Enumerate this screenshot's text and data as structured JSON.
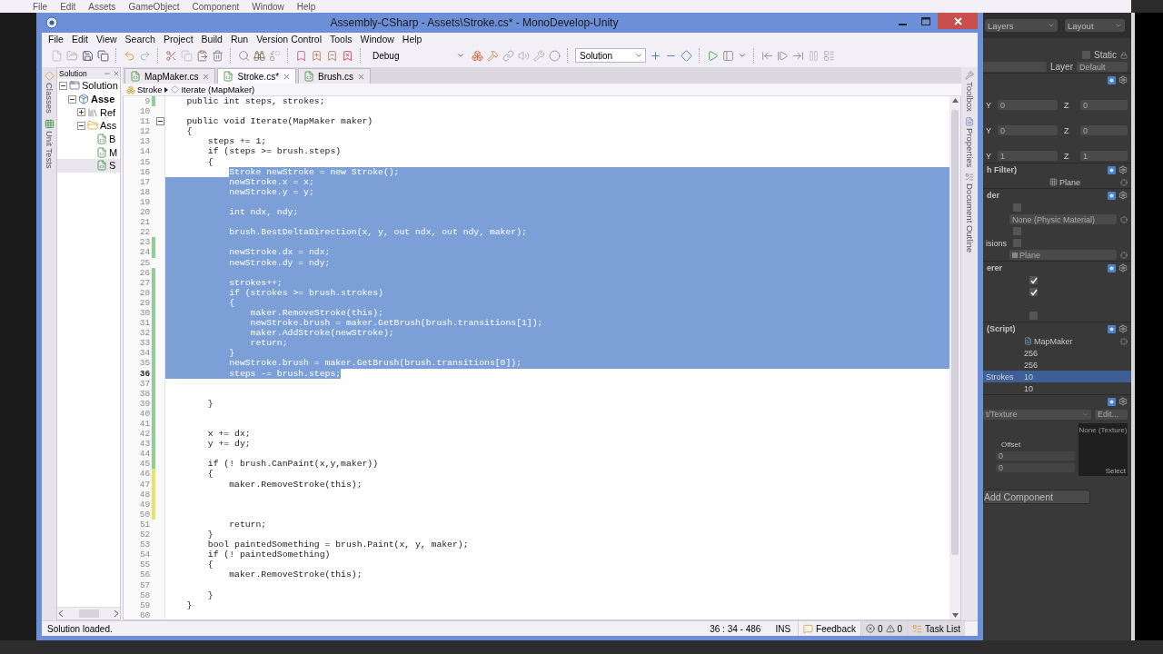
{
  "unity_menu": [
    "File",
    "Edit",
    "Assets",
    "GameObject",
    "Component",
    "Window",
    "Help"
  ],
  "window": {
    "title": "Assembly-CSharp - Assets\\Stroke.cs* - MonoDevelop-Unity"
  },
  "menu": [
    "File",
    "Edit",
    "View",
    "Search",
    "Project",
    "Build",
    "Run",
    "Version Control",
    "Tools",
    "Window",
    "Help"
  ],
  "toolbar": {
    "configuration": "Debug",
    "target": "Solution"
  },
  "left_pads": [
    "Classes",
    "Unit Tests"
  ],
  "solution_panel": {
    "title": "Solution",
    "tree": [
      {
        "label": "Solution",
        "kind": "solution",
        "expanded": true,
        "selected": false,
        "children": [
          {
            "label": "Asse",
            "kind": "project",
            "expanded": true,
            "selected": false,
            "children": [
              {
                "label": "Ref",
                "kind": "references",
                "expanded": false,
                "selected": false
              },
              {
                "label": "Ass",
                "kind": "folder",
                "expanded": true,
                "selected": false,
                "children": [
                  {
                    "label": "B",
                    "kind": "file",
                    "selected": false
                  },
                  {
                    "label": "M",
                    "kind": "file",
                    "selected": false
                  },
                  {
                    "label": "S",
                    "kind": "file",
                    "selected": true
                  }
                ]
              }
            ]
          }
        ]
      }
    ]
  },
  "tabs": [
    {
      "label": "MapMaker.cs",
      "selected": false
    },
    {
      "label": "Stroke.cs*",
      "selected": true
    },
    {
      "label": "Brush.cs",
      "selected": false
    }
  ],
  "breadcrumb": {
    "class": "Stroke",
    "member": "Iterate (MapMaker)"
  },
  "editor": {
    "lines": [
      {
        "number": "9",
        "text": "    public int steps, strokes;",
        "selected": false,
        "color": "#8fd18f",
        "current": false,
        "fold": false
      },
      {
        "number": "10",
        "selected": false,
        "current": false,
        "fold": false
      },
      {
        "number": "11",
        "text": "    public void Iterate(MapMaker maker)",
        "selected": false,
        "current": false,
        "fold": true
      },
      {
        "number": "12",
        "text": "    {",
        "selected": false,
        "current": false,
        "fold": false
      },
      {
        "number": "13",
        "text": "        steps += 1;",
        "selected": false,
        "current": false,
        "fold": false
      },
      {
        "number": "14",
        "text": "        if (steps >= brush.steps)",
        "selected": false,
        "current": false,
        "fold": false
      },
      {
        "number": "15",
        "text": "        {",
        "selected": false,
        "current": false,
        "fold": false
      },
      {
        "number": "16",
        "text": "            Stroke newStroke = new Stroke();",
        "selected": true,
        "current": false,
        "fold": false
      },
      {
        "number": "17",
        "text": "            newStroke.x = x;",
        "selected": true,
        "current": false,
        "fold": false
      },
      {
        "number": "18",
        "text": "            newStroke.y = y;",
        "selected": true,
        "current": false,
        "fold": false
      },
      {
        "number": "19",
        "selected": true,
        "current": false,
        "fold": false
      },
      {
        "number": "20",
        "text": "            int ndx, ndy;",
        "selected": true,
        "current": false,
        "fold": false
      },
      {
        "number": "21",
        "selected": true,
        "current": false,
        "fold": false
      },
      {
        "number": "22",
        "text": "            brush.BestDeltaDirection(x, y, out ndx, out ndy, maker);",
        "selected": true,
        "current": false,
        "fold": false
      },
      {
        "number": "23",
        "selected": true,
        "color": "#8fd18f",
        "current": false,
        "fold": false
      },
      {
        "number": "24",
        "text": "            newStroke.dx = ndx;",
        "selected": true,
        "color": "#8fd18f",
        "current": false,
        "fold": false
      },
      {
        "number": "25",
        "text": "            newStroke.dy = ndy;",
        "selected": true,
        "current": false,
        "fold": false
      },
      {
        "number": "26",
        "selected": true,
        "color": "#8fd18f",
        "current": false,
        "fold": false
      },
      {
        "number": "27",
        "text": "            strokes++;",
        "selected": true,
        "color": "#8fd18f",
        "current": false,
        "fold": false
      },
      {
        "number": "28",
        "text": "            if (strokes >= brush.strokes)",
        "selected": true,
        "color": "#8fd18f",
        "current": false,
        "fold": false
      },
      {
        "number": "29",
        "text": "            {",
        "selected": true,
        "color": "#8fd18f",
        "current": false,
        "fold": false
      },
      {
        "number": "30",
        "text": "                maker.RemoveStroke(this);",
        "selected": true,
        "color": "#8fd18f",
        "current": false,
        "fold": false
      },
      {
        "number": "31",
        "text": "                newStroke.brush = maker.GetBrush(brush.transitions[1]);",
        "selected": true,
        "color": "#8fd18f",
        "current": false,
        "fold": false
      },
      {
        "number": "32",
        "text": "                maker.AddStroke(newStroke);",
        "selected": true,
        "color": "#8fd18f",
        "current": false,
        "fold": false
      },
      {
        "number": "33",
        "text": "                return;",
        "selected": true,
        "color": "#8fd18f",
        "current": false,
        "fold": false
      },
      {
        "number": "34",
        "text": "            }",
        "selected": true,
        "color": "#8fd18f",
        "current": false,
        "fold": false
      },
      {
        "number": "35",
        "text": "            newStroke.brush = maker.GetBrush(brush.transitions[0]);",
        "selected": true,
        "color": "#8fd18f",
        "current": false,
        "fold": false
      },
      {
        "number": "36",
        "text": "            steps -= brush.steps;",
        "selected": true,
        "color": "#8fd18f",
        "current": true,
        "fold": false
      },
      {
        "number": "37",
        "selected": false,
        "color": "#8fd18f",
        "current": false,
        "fold": false
      },
      {
        "number": "38",
        "selected": false,
        "color": "#8fd18f",
        "current": false,
        "fold": false
      },
      {
        "number": "39",
        "text": "        }",
        "selected": false,
        "color": "#8fd18f",
        "current": false,
        "fold": false
      },
      {
        "number": "40",
        "selected": false,
        "color": "#8fd18f",
        "current": false,
        "fold": false
      },
      {
        "number": "41",
        "selected": false,
        "color": "#8fd18f",
        "current": false,
        "fold": false
      },
      {
        "number": "42",
        "text": "        x += dx;",
        "selected": false,
        "color": "#8fd18f",
        "current": false,
        "fold": false
      },
      {
        "number": "43",
        "text": "        y += dy;",
        "selected": false,
        "color": "#8fd18f",
        "current": false,
        "fold": false
      },
      {
        "number": "44",
        "selected": false,
        "color": "#8fd18f",
        "current": false,
        "fold": false
      },
      {
        "number": "45",
        "text": "        if (! brush.CanPaint(x,y,maker))",
        "selected": false,
        "color": "#8fd18f",
        "current": false,
        "fold": false
      },
      {
        "number": "46",
        "text": "        {",
        "selected": false,
        "color": "#e9e36a",
        "current": false,
        "fold": false
      },
      {
        "number": "47",
        "text": "            maker.RemoveStroke(this);",
        "selected": false,
        "color": "#e9e36a",
        "current": false,
        "fold": false
      },
      {
        "number": "48",
        "selected": false,
        "color": "#e9e36a",
        "current": false,
        "fold": false
      },
      {
        "number": "49",
        "selected": false,
        "color": "#e9e36a",
        "current": false,
        "fold": false
      },
      {
        "number": "50",
        "selected": false,
        "color": "#e9e36a",
        "current": false,
        "fold": false
      },
      {
        "number": "51",
        "text": "            return;",
        "selected": false,
        "current": false,
        "fold": false
      },
      {
        "number": "52",
        "text": "        }",
        "selected": false,
        "current": false,
        "fold": false
      },
      {
        "number": "53",
        "text": "        bool paintedSomething = brush.Paint(x, y, maker);",
        "selected": false,
        "current": false,
        "fold": false
      },
      {
        "number": "54",
        "text": "        if (! paintedSomething)",
        "selected": false,
        "current": false,
        "fold": false
      },
      {
        "number": "55",
        "text": "        {",
        "selected": false,
        "current": false,
        "fold": false
      },
      {
        "number": "56",
        "text": "            maker.RemoveStroke(this);",
        "selected": false,
        "current": false,
        "fold": false
      },
      {
        "number": "57",
        "selected": false,
        "current": false,
        "fold": false
      },
      {
        "number": "58",
        "text": "        }",
        "selected": false,
        "current": false,
        "fold": false
      },
      {
        "number": "59",
        "text": "    }",
        "selected": false,
        "current": false,
        "fold": false
      },
      {
        "number": "60",
        "selected": false,
        "current": false,
        "fold": false
      }
    ]
  },
  "right_pads": [
    "Toolbox",
    "Properties",
    "Document Outline"
  ],
  "status_bar": {
    "message": "Solution loaded.",
    "position": "36 : 34 - 486",
    "mode": "INS",
    "feedback": "Feedback",
    "errors": "0",
    "warnings": "0",
    "task_list": "Task List"
  },
  "inspector": {
    "layers": "Layers",
    "layout": "Layout",
    "static": "Static",
    "static_checked": false,
    "layer_label": "Layer",
    "layer": "Default",
    "rows": [
      {
        "kind": "header"
      },
      {
        "kind": "vector",
        "labels": [
          "Y",
          "Z"
        ],
        "values": [
          "0",
          "0"
        ]
      },
      {
        "kind": "vector",
        "labels": [
          "Y",
          "Z"
        ],
        "values": [
          "0",
          "0"
        ]
      },
      {
        "kind": "vector",
        "labels": [
          "Y",
          "Z"
        ],
        "values": [
          "1",
          "1"
        ]
      },
      {
        "kind": "header",
        "title": "h Filter)"
      },
      {
        "kind": "mesh",
        "value": "Plane"
      },
      {
        "kind": "header",
        "title": "der"
      },
      {
        "kind": "checkbox",
        "checked": false
      },
      {
        "kind": "field",
        "value": "None (Physic Material)"
      },
      {
        "kind": "checkbox",
        "checked": false
      },
      {
        "kind": "checkbox",
        "label": "isions",
        "checked": false
      },
      {
        "kind": "asset",
        "value": "Plane"
      },
      {
        "kind": "header",
        "title": "erer"
      },
      {
        "kind": "toggle",
        "checked": true
      },
      {
        "kind": "toggle",
        "checked": true
      },
      {
        "kind": "spacer"
      },
      {
        "kind": "toggle",
        "checked": false
      },
      {
        "kind": "header",
        "title": "(Script)"
      },
      {
        "kind": "script",
        "value": "MapMaker"
      },
      {
        "kind": "value",
        "value": "256",
        "selected": false
      },
      {
        "kind": "value",
        "value": "256",
        "selected": false
      },
      {
        "kind": "value",
        "label": "Strokes",
        "value": "10",
        "selected": true
      },
      {
        "kind": "value",
        "value": "10",
        "selected": false
      },
      {
        "kind": "header"
      },
      {
        "kind": "shader",
        "value": "t/Texture",
        "button": "Edit..."
      },
      {
        "kind": "texture",
        "label": "Offset",
        "values": [
          "0",
          "0"
        ],
        "preview": "None (Texture)",
        "action": "Select"
      }
    ],
    "add_component": "Add Component"
  }
}
